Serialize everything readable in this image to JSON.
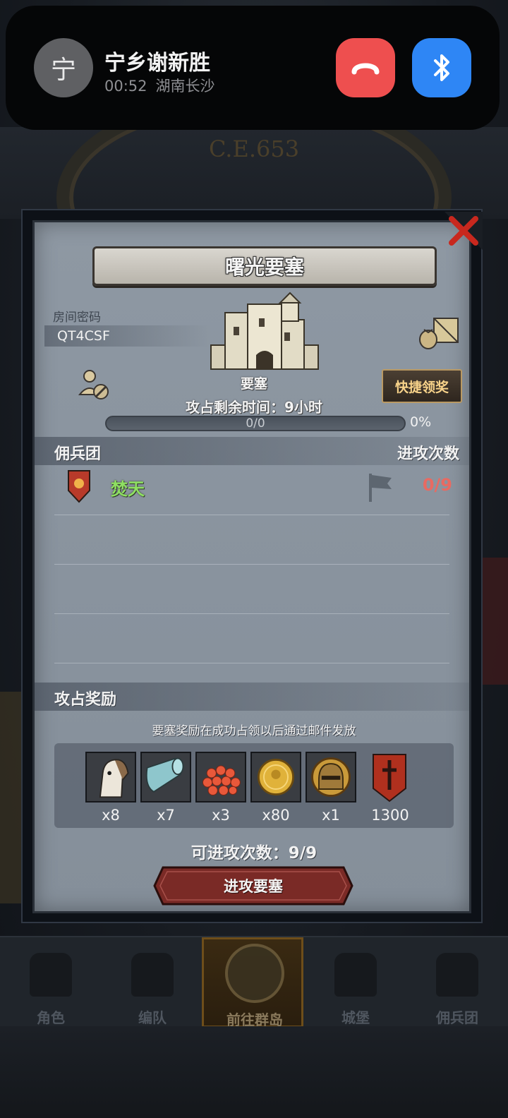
{
  "call_banner": {
    "avatar_char": "宁",
    "caller_name": "宁乡谢新胜",
    "duration": "00:52",
    "location": "湖南长沙"
  },
  "background": {
    "era_text": "C.E.653"
  },
  "dialog": {
    "title": "曙光要塞",
    "room_label": "房间密码",
    "room_code": "QT4CSF",
    "building_label": "要塞",
    "quick_claim_label": "快捷领奖",
    "remaining_time": "攻占剩余时间：9小时",
    "progress": {
      "text": "0/0",
      "percent_text": "0%",
      "fraction": 0
    },
    "mercenary_header": "佣兵团",
    "attack_count_header": "进攻次数",
    "mercenaries": [
      {
        "name": "焚天",
        "attacks": "0/9",
        "name_color": "#8fe062",
        "count_color": "#e86a62"
      }
    ],
    "rewards_header": "攻占奖励",
    "rewards_note": "要塞奖励在成功占领以后通过邮件发放",
    "rewards": [
      {
        "icon": "horse-icon",
        "qty": "x8"
      },
      {
        "icon": "cloth-roll-icon",
        "qty": "x7"
      },
      {
        "icon": "red-beans-icon",
        "qty": "x3"
      },
      {
        "icon": "gold-coin-icon",
        "qty": "x80"
      },
      {
        "icon": "knight-helmet-icon",
        "qty": "x1"
      },
      {
        "icon": "guild-banner-icon",
        "qty": "1300"
      }
    ],
    "available_attacks": "可进攻次数：9/9",
    "attack_button": "进攻要塞"
  },
  "nav": {
    "items": [
      {
        "label": "角色",
        "active": false
      },
      {
        "label": "编队",
        "active": false
      },
      {
        "label": "前往群岛",
        "active": true
      },
      {
        "label": "城堡",
        "active": false
      },
      {
        "label": "佣兵团",
        "active": false
      }
    ]
  },
  "colors": {
    "hangup": "#ee4f4f",
    "bluetooth": "#2e86f5",
    "quick_claim_text": "#f8d38a",
    "attack_button": "#7a2a26"
  }
}
